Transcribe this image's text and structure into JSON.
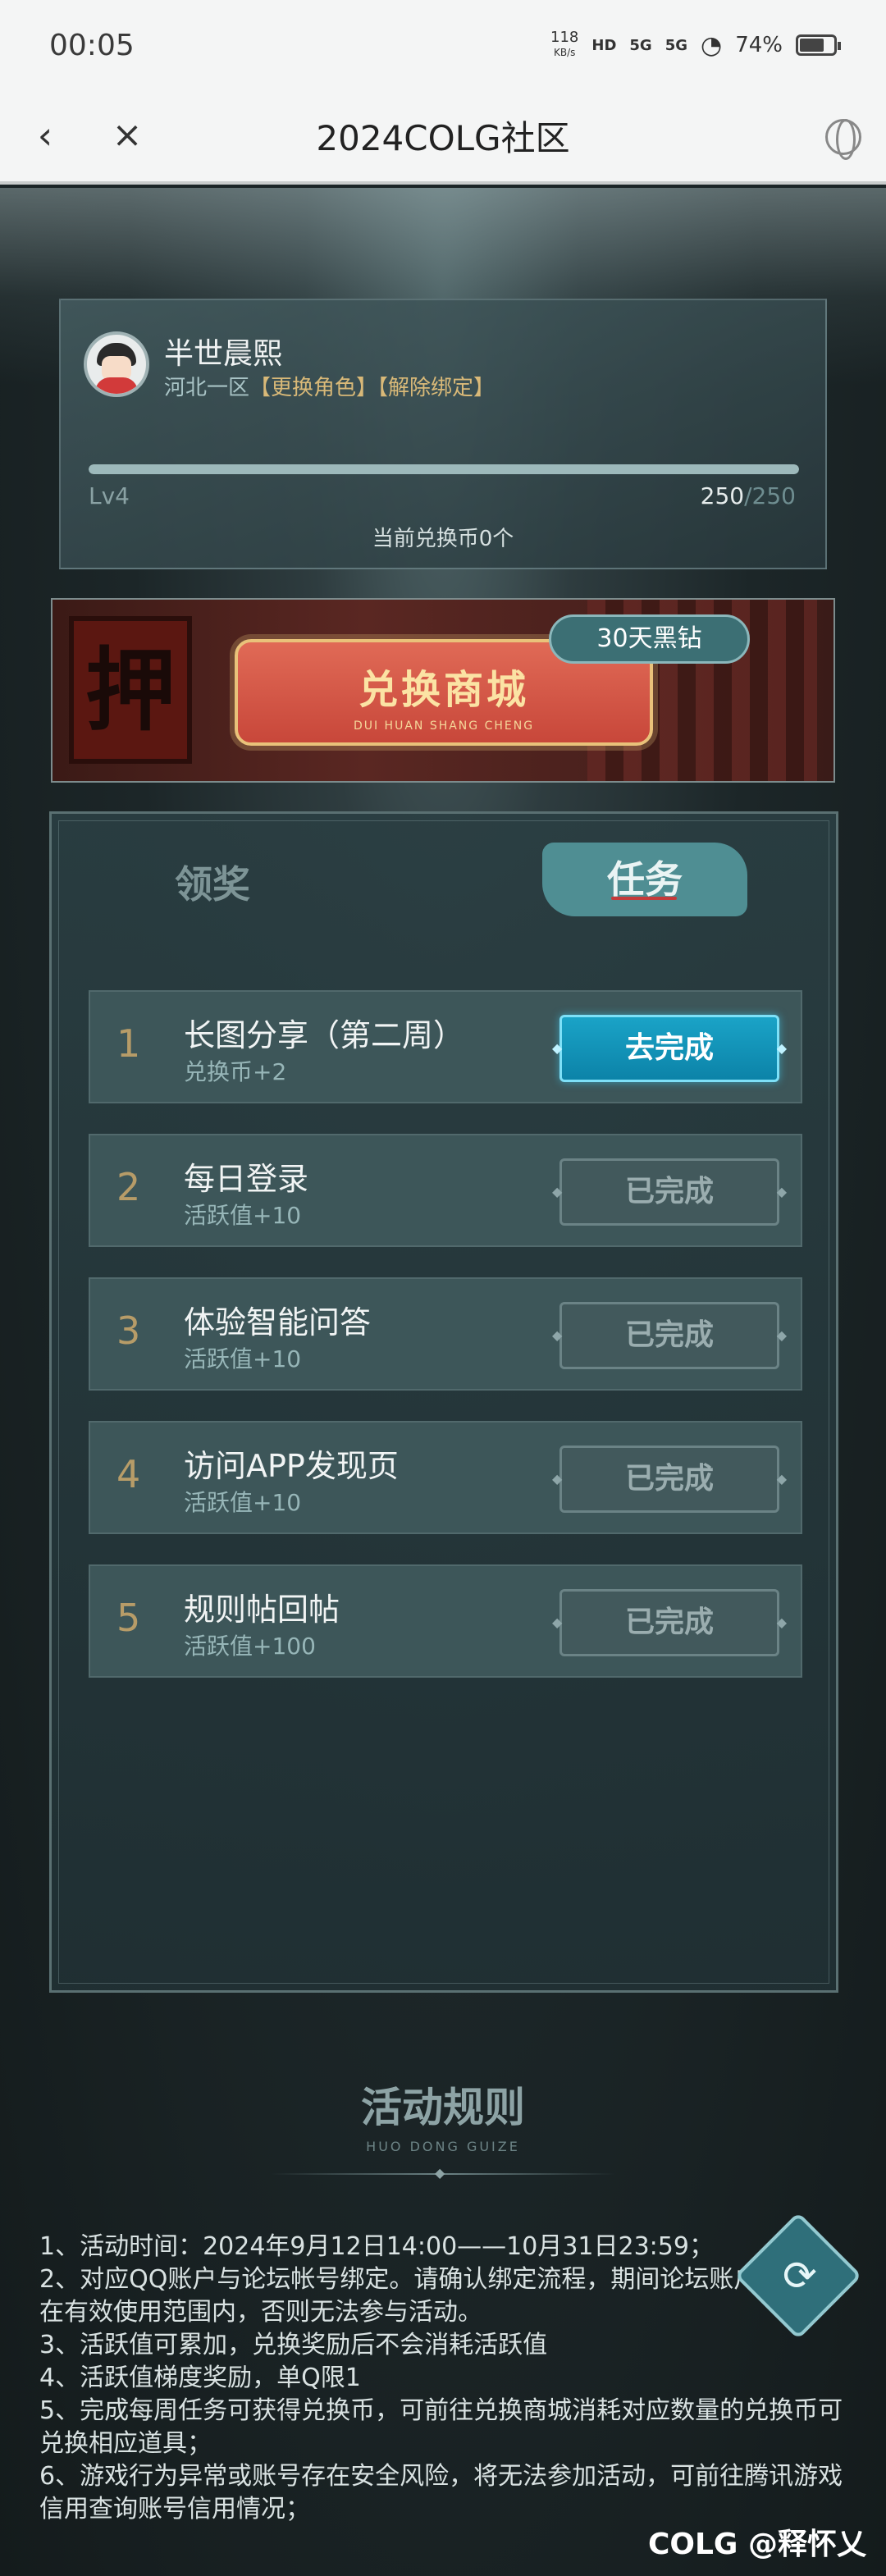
{
  "status_bar": {
    "time": "00:05",
    "net_speed_value": "118",
    "net_speed_unit": "KB/s",
    "hd_label": "HD",
    "sig1": "5G",
    "sig2": "5G",
    "battery": "74%",
    "battery_level": 0.74
  },
  "nav": {
    "title": "2024COLG社区",
    "back_icon": "back-arrow-icon",
    "close_icon": "close-icon",
    "globe_icon": "globe-icon"
  },
  "profile": {
    "name": "半世晨熙",
    "server": "河北一区",
    "change_role": "【更换角色】",
    "unbind": "【解除绑定】",
    "level": "Lv4",
    "exp_current": "250",
    "exp_max": "/250",
    "exp_ratio": 1.0,
    "coins_text": "当前兑换币0个"
  },
  "shop": {
    "seal_char": "押",
    "title": "兑换商城",
    "subtitle": "DUI HUAN SHANG CHENG",
    "badge": "30天黑钻"
  },
  "tabs": {
    "reward": "领奖",
    "task": "任务"
  },
  "tasks": [
    {
      "num": "1",
      "name": "长图分享（第二周）",
      "sub": "兑换币+2",
      "button": "去完成",
      "active": true
    },
    {
      "num": "2",
      "name": "每日登录",
      "sub": "活跃值+10",
      "button": "已完成",
      "active": false
    },
    {
      "num": "3",
      "name": "体验智能问答",
      "sub": "活跃值+10",
      "button": "已完成",
      "active": false
    },
    {
      "num": "4",
      "name": "访问APP发现页",
      "sub": "活跃值+10",
      "button": "已完成",
      "active": false
    },
    {
      "num": "5",
      "name": "规则帖回帖",
      "sub": "活跃值+100",
      "button": "已完成",
      "active": false
    }
  ],
  "rules": {
    "title": "活动规则",
    "subtitle": "HUO DONG GUIZE",
    "items": [
      "1、活动时间：2024年9月12日14:00——10月31日23:59；",
      "2、对应QQ账户与论坛帐号绑定。请确认绑定流程，期间论坛账户在有效使用范围内，否则无法参与活动。",
      "3、活跃值可累加，兑换奖励后不会消耗活跃值",
      "4、活跃值梯度奖励，单Q限1",
      "5、完成每周任务可获得兑换币，可前往兑换商城消耗对应数量的兑换币可兑换相应道具；",
      "6、游戏行为异常或账号存在安全风险，将无法参加活动，可前往腾讯游戏信用查询账号信用情况；"
    ]
  },
  "watermark": "COLG @释怀乂",
  "refresh_icon": "refresh-icon"
}
